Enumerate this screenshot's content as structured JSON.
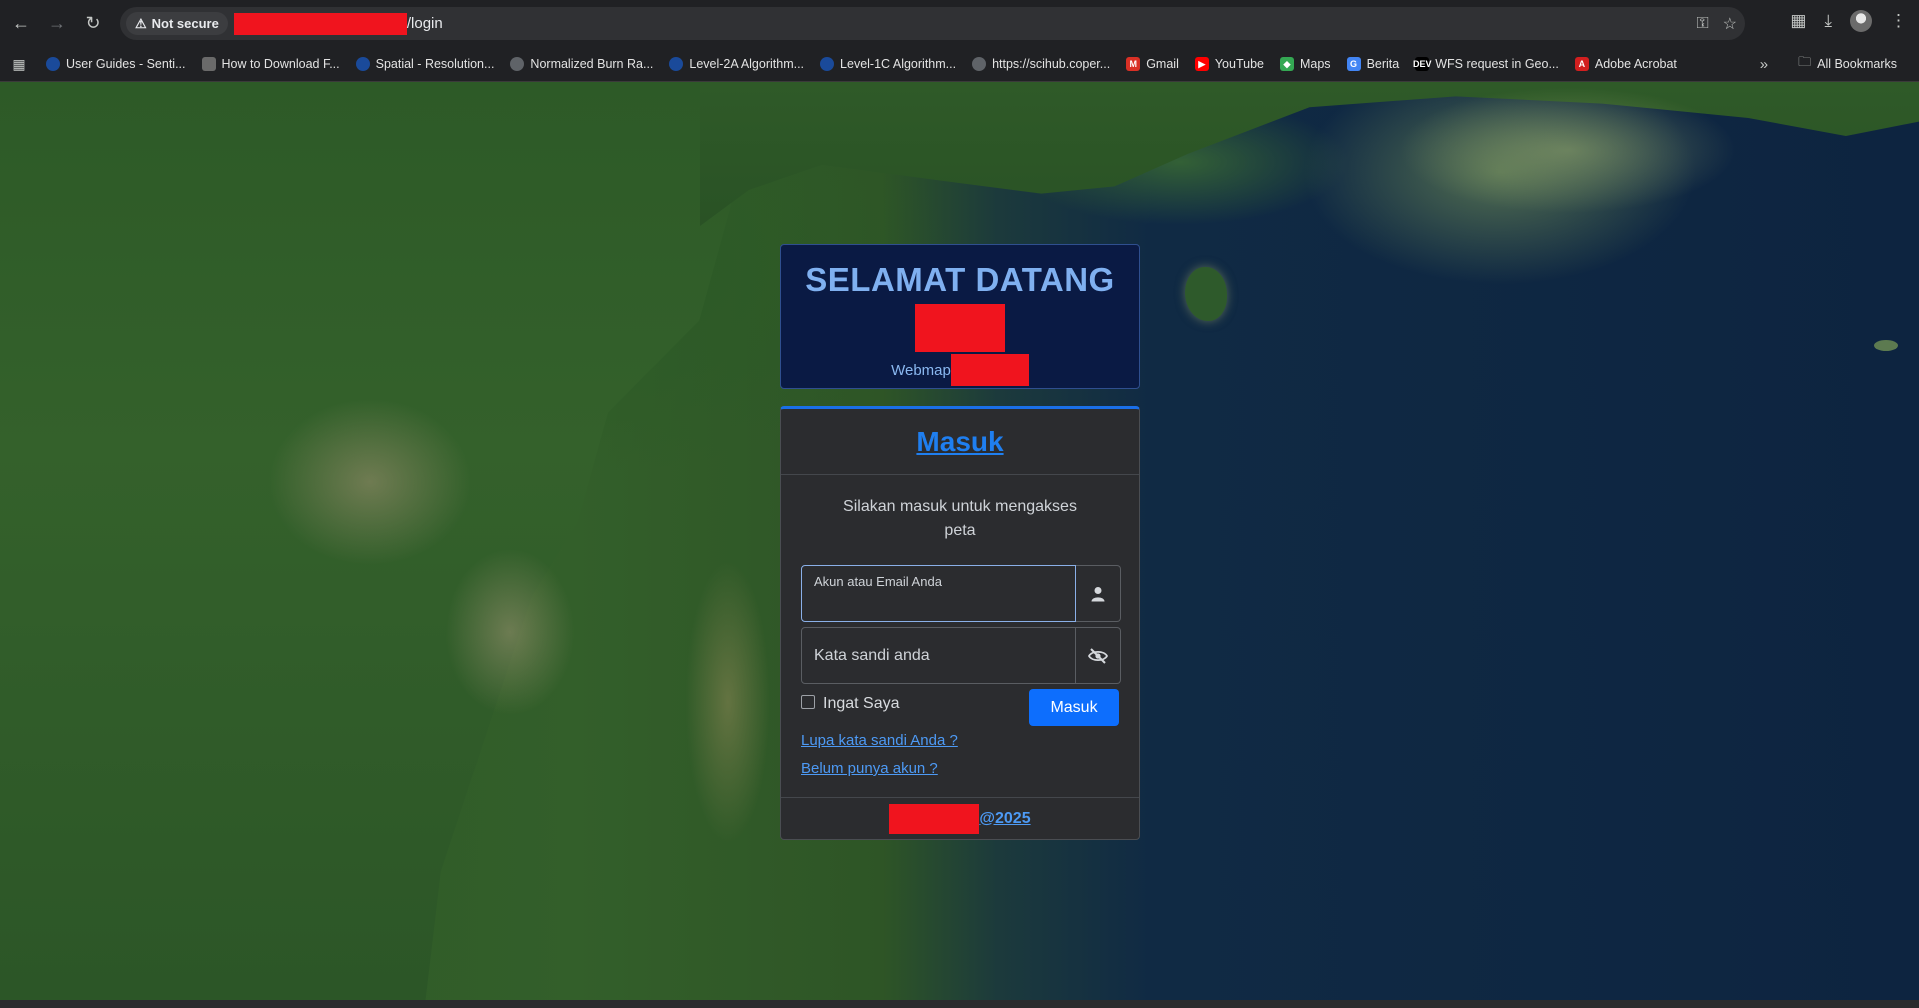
{
  "browser": {
    "security_label": "Not secure",
    "url_path": "/login",
    "icons": [
      "back-arrow-icon",
      "forward-arrow-icon",
      "reload-icon",
      "warning-icon",
      "key-icon",
      "star-icon",
      "extensions-icon",
      "download-icon",
      "avatar",
      "kebab-menu-icon"
    ]
  },
  "bookmarks": {
    "items": [
      {
        "label": "User Guides - Senti...",
        "icon": "globe",
        "color": "#1a4a9a"
      },
      {
        "label": "How to Download F...",
        "icon": "gis",
        "color": "#6a6a6a"
      },
      {
        "label": "Spatial - Resolution...",
        "icon": "globe",
        "color": "#1a4a9a"
      },
      {
        "label": "Normalized Burn Ra...",
        "icon": "globe",
        "color": "#5f6368"
      },
      {
        "label": "Level-2A Algorithm...",
        "icon": "globe",
        "color": "#1a4a9a"
      },
      {
        "label": "Level-1C Algorithm...",
        "icon": "globe",
        "color": "#1a4a9a"
      },
      {
        "label": "https://scihub.coper...",
        "icon": "globe",
        "color": "#5f6368"
      },
      {
        "label": "Gmail",
        "icon": "M",
        "color": "#d93025"
      },
      {
        "label": "YouTube",
        "icon": "▶",
        "color": "#ff0000"
      },
      {
        "label": "Maps",
        "icon": "◆",
        "color": "#34a853"
      },
      {
        "label": "Berita",
        "icon": "G",
        "color": "#4285f4"
      },
      {
        "label": "WFS request in Geo...",
        "icon": "DEV",
        "color": "#000000"
      },
      {
        "label": "Adobe Acrobat",
        "icon": "A",
        "color": "#d21f1f"
      }
    ],
    "more": "»",
    "all_label": "All Bookmarks"
  },
  "welcome": {
    "title": "SELAMAT DATANG",
    "webmap_label": "Webmap"
  },
  "login": {
    "title": "Masuk",
    "subtitle": "Silakan masuk untuk mengakses peta",
    "username_placeholder": "Akun atau Email Anda",
    "password_placeholder": "Kata sandi anda",
    "remember_label": "Ingat Saya",
    "submit_label": "Masuk",
    "forgot_link": "Lupa kata sandi Anda ?",
    "register_link": "Belum punya akun ?",
    "footer_suffix": "@2025"
  },
  "colors": {
    "accent": "#0d6efd",
    "redaction": "#f0141e",
    "header_bg": "#0a1a44"
  }
}
